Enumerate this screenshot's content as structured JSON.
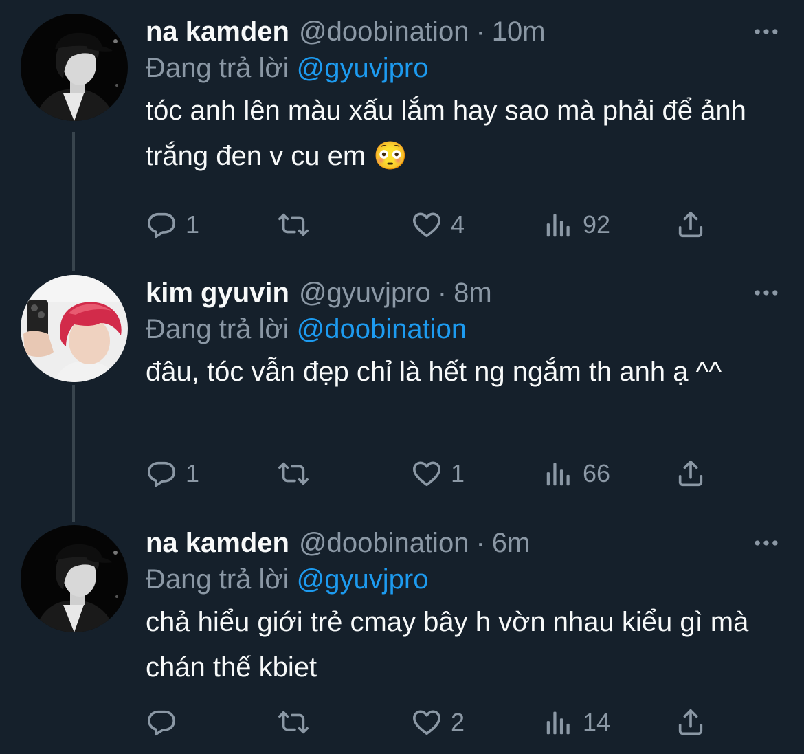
{
  "tweets": [
    {
      "name": "na kamden",
      "handle": "@doobination",
      "separator": "·",
      "time": "10m",
      "replying_prefix": "Đang trả lời",
      "replying_to": "@gyuvjpro",
      "text": "tóc anh lên màu xấu lắm hay sao mà phải để ảnh trắng đen v cu em 😳",
      "reply_count": "1",
      "retweet_count": "",
      "like_count": "4",
      "view_count": "92",
      "avatar": "bw-portrait-cap"
    },
    {
      "name": "kim gyuvin",
      "handle": "@gyuvjpro",
      "separator": "·",
      "time": "8m",
      "replying_prefix": "Đang trả lời",
      "replying_to": "@doobination",
      "text": "đâu, tóc vẫn đẹp chỉ là hết ng ngắm th anh ạ ^^",
      "reply_count": "1",
      "retweet_count": "",
      "like_count": "1",
      "view_count": "66",
      "avatar": "red-hair-selfie"
    },
    {
      "name": "na kamden",
      "handle": "@doobination",
      "separator": "·",
      "time": "6m",
      "replying_prefix": "Đang trả lời",
      "replying_to": "@gyuvjpro",
      "text": "chả hiểu giới trẻ cmay bây h vờn nhau kiểu gì mà chán thế kbiet",
      "reply_count": "",
      "retweet_count": "",
      "like_count": "2",
      "view_count": "14",
      "avatar": "bw-portrait-cap"
    }
  ],
  "icons": [
    "more-icon",
    "reply-icon",
    "retweet-icon",
    "like-icon",
    "views-icon",
    "share-icon"
  ],
  "colors": {
    "background": "#15202b",
    "text": "#f7f9f9",
    "muted": "#8b98a5",
    "link": "#1d9bf0",
    "thread_line": "#38444d"
  }
}
